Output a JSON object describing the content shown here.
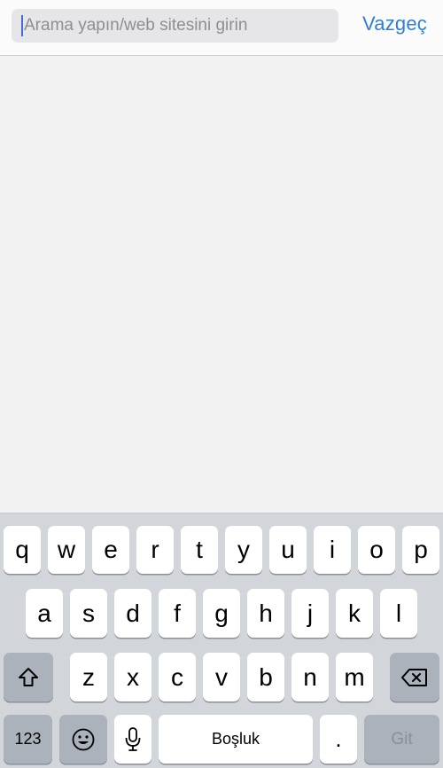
{
  "search": {
    "placeholder": "Arama yapın/web sitesini girin",
    "value": "",
    "cancel_label": "Vazgeç"
  },
  "keyboard": {
    "row1": [
      "q",
      "w",
      "e",
      "r",
      "t",
      "y",
      "u",
      "i",
      "o",
      "p"
    ],
    "row2": [
      "a",
      "s",
      "d",
      "f",
      "g",
      "h",
      "j",
      "k",
      "l"
    ],
    "row3": [
      "z",
      "x",
      "c",
      "v",
      "b",
      "n",
      "m"
    ],
    "numbers_label": "123",
    "space_label": "Boşluk",
    "period_label": ".",
    "return_label": "Git",
    "icons": {
      "shift": "shift-icon",
      "backspace": "backspace-icon",
      "emoji": "emoji-icon",
      "dictation": "microphone-icon"
    }
  },
  "colors": {
    "accent": "#2f7fd4",
    "caret": "#4a67d6",
    "keyboard_bg": "#d2d5da",
    "function_key": "#acb2bb"
  }
}
